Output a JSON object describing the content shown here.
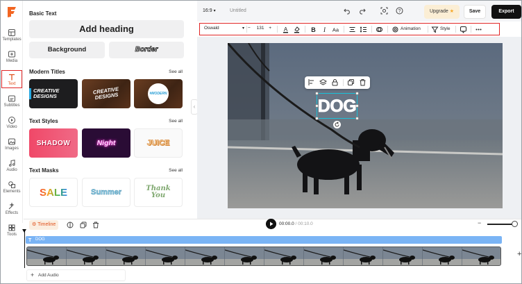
{
  "app": {
    "accent": "#e0521d",
    "highlight": "#e02424"
  },
  "rail": {
    "items": [
      {
        "label": "Templates",
        "icon": "templates-icon"
      },
      {
        "label": "Media",
        "icon": "media-icon"
      },
      {
        "label": "Text",
        "icon": "text-icon"
      },
      {
        "label": "Subtitles",
        "icon": "subtitles-icon"
      },
      {
        "label": "Video",
        "icon": "video-icon"
      },
      {
        "label": "Images",
        "icon": "images-icon"
      },
      {
        "label": "Audio",
        "icon": "audio-icon"
      },
      {
        "label": "Elements",
        "icon": "elements-icon"
      },
      {
        "label": "Effects",
        "icon": "effects-icon"
      },
      {
        "label": "Tools",
        "icon": "tools-icon"
      }
    ],
    "active": "Text"
  },
  "panel": {
    "basic_title": "Basic Text",
    "add_heading": "Add heading",
    "background": "Background",
    "border": "Border",
    "modern_title": "Modern Titles",
    "styles_title": "Text Styles",
    "masks_title": "Text Masks",
    "see_all": "See all",
    "modern": [
      "CREATIVE DESIGNS",
      "CREATIVE DESIGNS",
      "#MODERN DESIGN"
    ],
    "styles": [
      "SHADOW",
      "Night",
      "JUICE"
    ],
    "masks": [
      "SALE",
      "Summer",
      "Thank You"
    ]
  },
  "topbar": {
    "ratio": "16:9",
    "title": "Untitled",
    "upgrade": "Upgrade",
    "save": "Save",
    "export": "Export"
  },
  "toolbar": {
    "font": "Oswald",
    "size": "131",
    "animation": "Animation",
    "style": "Style"
  },
  "canvas": {
    "text": "DOG"
  },
  "timeline": {
    "label": "Timeline",
    "current": "00:00.0",
    "duration": "/ 00:10.0",
    "text_clip": "DOG",
    "add_audio": "Add Audio"
  }
}
